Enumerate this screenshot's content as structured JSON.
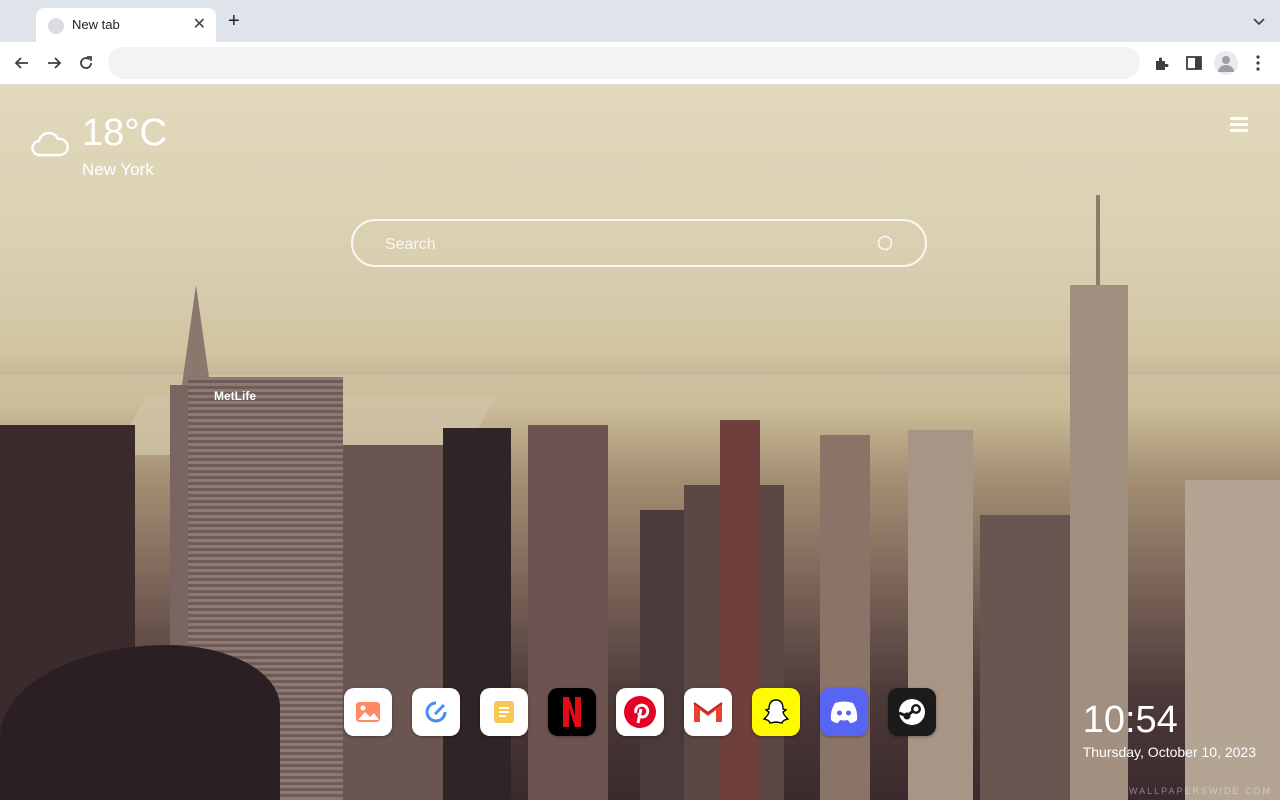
{
  "browser": {
    "tab_title": "New tab",
    "omnibox_value": ""
  },
  "weather": {
    "temperature": "18°C",
    "city": "New York",
    "icon": "cloud-icon"
  },
  "search": {
    "placeholder": "Search"
  },
  "apps": [
    {
      "name": "photos-app",
      "icon": "image-icon"
    },
    {
      "name": "edit-app",
      "icon": "pencil-icon"
    },
    {
      "name": "notes-app",
      "icon": "note-icon"
    },
    {
      "name": "netflix-app",
      "icon": "netflix-icon"
    },
    {
      "name": "pinterest-app",
      "icon": "pinterest-icon"
    },
    {
      "name": "gmail-app",
      "icon": "gmail-icon"
    },
    {
      "name": "snapchat-app",
      "icon": "snapchat-icon"
    },
    {
      "name": "discord-app",
      "icon": "discord-icon"
    },
    {
      "name": "steam-app",
      "icon": "steam-icon"
    }
  ],
  "clock": {
    "time": "10:54",
    "date": "Thursday, October 10, 2023"
  },
  "background": {
    "sign_text": "MetLife",
    "watermark": "WALLPAPERSWIDE.COM"
  },
  "colors": {
    "netflix_red": "#e50914",
    "pinterest_red": "#e60023",
    "snapchat_yellow": "#fffc00",
    "discord_blurple": "#5865f2",
    "steam_dark": "#1b2838"
  }
}
